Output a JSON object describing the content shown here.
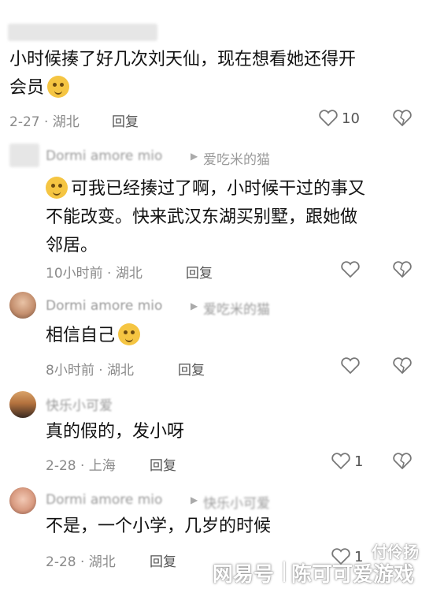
{
  "reply_label": "回复",
  "comments": [
    {
      "text_line1": "小时候揍了好几次刘天仙，现在想看她还得开",
      "text_line2": "会员",
      "meta": "2-27 · 湖北",
      "likes": "10"
    },
    {
      "username": "Dormi amore mio",
      "reply_to": "爱吃米的猫",
      "text_line1": "可我已经揍过了啊，小时候干过的事又",
      "text_line2": "不能改变。快来武汉东湖买别墅，跟她做",
      "text_line3": "邻居。",
      "meta": "10小时前 · 湖北"
    },
    {
      "username": "Dormi amore mio",
      "reply_to": "爱吃米的猫",
      "text_line1": "相信自己",
      "meta": "8小时前 · 湖北"
    },
    {
      "username": "快乐小可爱",
      "text_line1": "真的假的，发小呀",
      "meta": "2-28 · 上海",
      "likes": "1"
    },
    {
      "username": "Dormi amore mio",
      "reply_to": "快乐小可爱",
      "text_line1": "不是，一个小学，几岁的时候",
      "meta": "2-28 · 湖北",
      "likes": "1"
    }
  ],
  "watermark": {
    "left": "网易号",
    "right": "陈可可爱游戏",
    "corner": "付伶扬"
  }
}
